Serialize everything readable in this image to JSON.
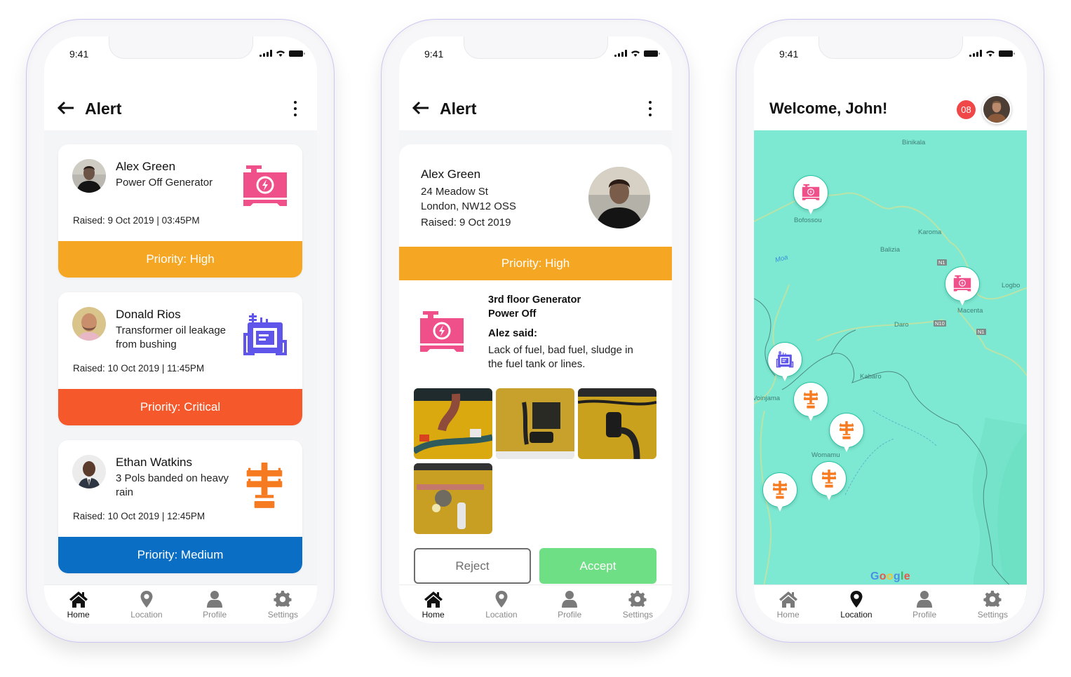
{
  "status_bar": {
    "time": "9:41"
  },
  "colors": {
    "priority_high": "#f5a623",
    "priority_critical": "#f5582a",
    "priority_medium": "#0b6ec5",
    "generator_icon": "#f0508a",
    "transformer_icon": "#6055ea",
    "pole_icon": "#f57a20",
    "accept": "#6fdf85",
    "map": "#7de9d2",
    "badge": "#f04848"
  },
  "screen1": {
    "title": "Alert",
    "alerts": [
      {
        "name": "Alex Green",
        "description": "Power Off Generator",
        "raised": "Raised: 9 Oct 2019 | 03:45PM",
        "priority": "Priority: High",
        "icon": "generator-icon"
      },
      {
        "name": "Donald Rios",
        "description": "Transformer oil leakage from bushing",
        "raised": "Raised: 10 Oct 2019 | 11:45PM",
        "priority": "Priority: Critical",
        "icon": "transformer-icon"
      },
      {
        "name": "Ethan Watkins",
        "description": "3 Pols banded on heavy rain",
        "raised": "Raised: 10 Oct 2019 | 12:45PM",
        "priority": "Priority: Medium",
        "icon": "utility-pole-icon"
      }
    ]
  },
  "screen2": {
    "title": "Alert",
    "name": "Alex Green",
    "address_line1": "24 Meadow St",
    "address_line2": "London, NW12 OSS",
    "raised": "Raised: 9 Oct 2019",
    "priority": "Priority: High",
    "issue_title_line1": "3rd floor Generator",
    "issue_title_line2": "Power Off",
    "said_label": "Alez said:",
    "message": "Lack of fuel, bad fuel, sludge in the fuel tank or lines.",
    "photos": [
      "engine-photo-1",
      "engine-photo-2",
      "engine-photo-3",
      "engine-photo-4"
    ],
    "reject_label": "Reject",
    "accept_label": "Accept"
  },
  "screen3": {
    "welcome": "Welcome, John!",
    "notification_count": "08",
    "map_labels": [
      "Binikala",
      "Bofossou",
      "Karoma",
      "Balizia",
      "Moa",
      "Logbo",
      "Macenta",
      "Daro",
      "Kabaro",
      "Voinjama",
      "Womamu"
    ],
    "road_badges": [
      "N1",
      "N10",
      "N1"
    ],
    "map_attribution": "Google",
    "pins": [
      {
        "type": "generator"
      },
      {
        "type": "generator"
      },
      {
        "type": "transformer"
      },
      {
        "type": "pole"
      },
      {
        "type": "pole"
      },
      {
        "type": "pole"
      },
      {
        "type": "pole"
      }
    ]
  },
  "nav": {
    "items": [
      {
        "label": "Home",
        "icon": "home-icon"
      },
      {
        "label": "Location",
        "icon": "location-pin-icon"
      },
      {
        "label": "Profile",
        "icon": "profile-icon"
      },
      {
        "label": "Settings",
        "icon": "gear-icon"
      }
    ],
    "active_screen1": "Home",
    "active_screen2": "Home",
    "active_screen3": "Location"
  }
}
